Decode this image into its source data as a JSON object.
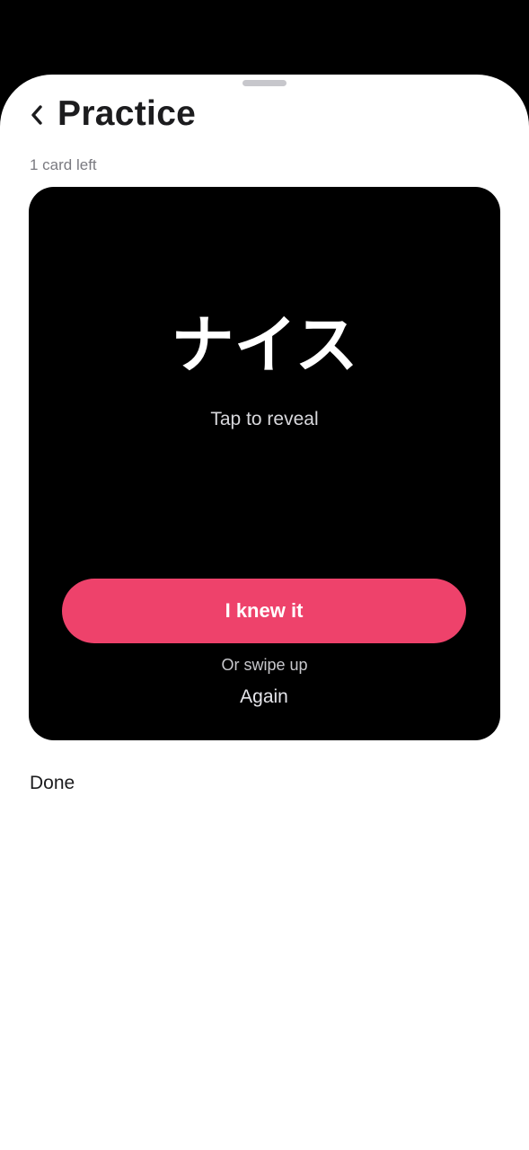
{
  "header": {
    "title": "Practice",
    "back_icon": "chevron-left-icon"
  },
  "progress": {
    "cards_left_label": "1 card left"
  },
  "card": {
    "term": "ナイス",
    "hint": "Tap to reveal",
    "primary_button_label": "I knew it",
    "swipe_hint": "Or swipe up",
    "secondary_button_label": "Again"
  },
  "footer": {
    "done_label": "Done"
  },
  "colors": {
    "accent": "#ee426b",
    "card_background": "#000000",
    "sheet_background": "#ffffff",
    "backdrop": "#000000"
  }
}
